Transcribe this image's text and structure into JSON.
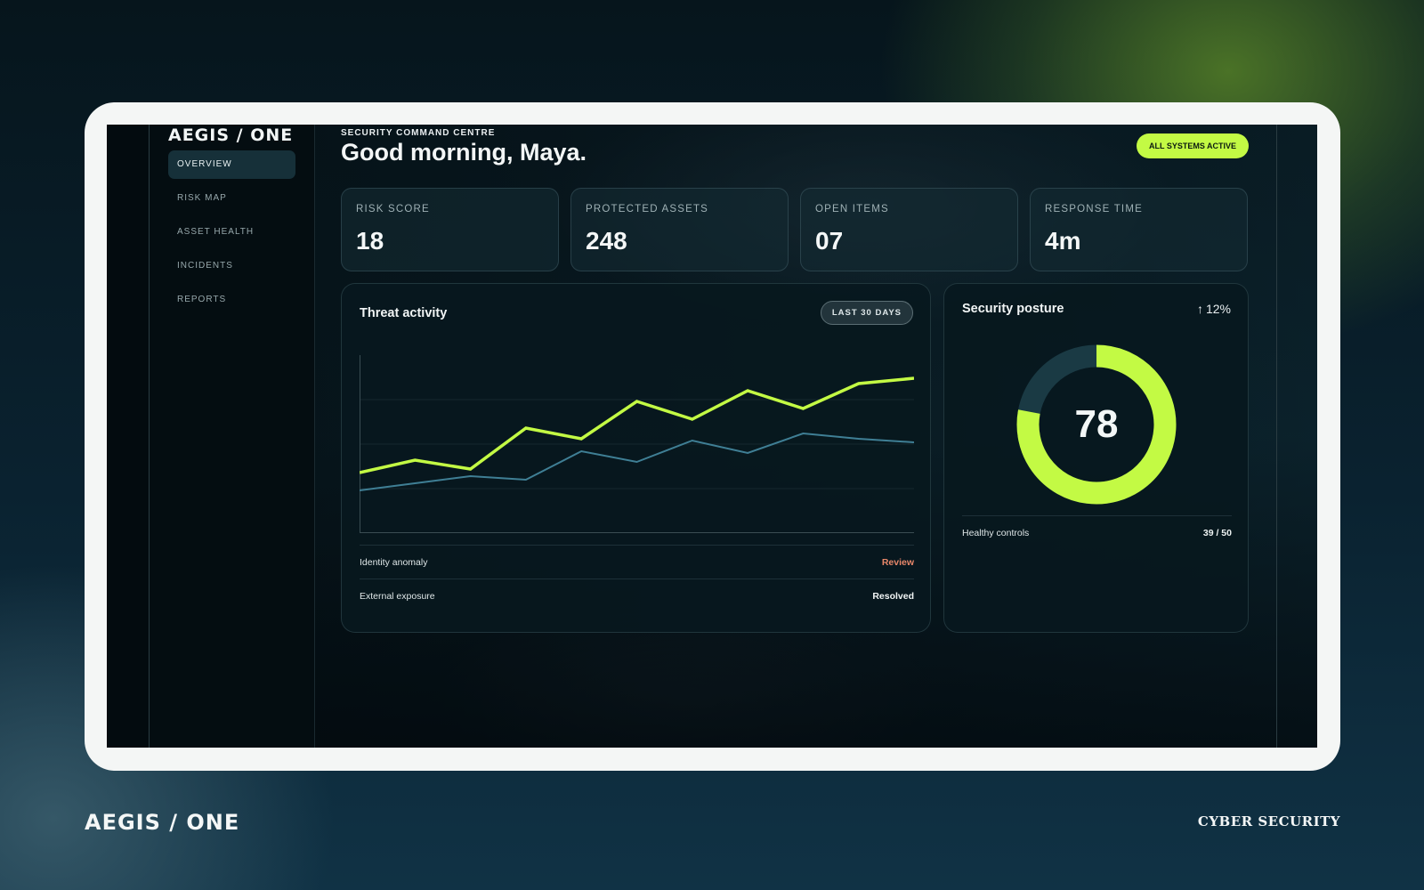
{
  "app": {
    "brand": "AEGIS / ONE",
    "footer_brand": "AEGIS / ONE",
    "footer_tag": "CYBER SECURITY"
  },
  "sidebar": {
    "items": [
      {
        "label": "OVERVIEW",
        "active": true
      },
      {
        "label": "RISK MAP",
        "active": false
      },
      {
        "label": "ASSET HEALTH",
        "active": false
      },
      {
        "label": "INCIDENTS",
        "active": false
      },
      {
        "label": "REPORTS",
        "active": false
      }
    ]
  },
  "header": {
    "eyebrow": "SECURITY COMMAND CENTRE",
    "greeting": "Good morning, Maya.",
    "status": "ALL SYSTEMS ACTIVE"
  },
  "kpis": [
    {
      "label": "RISK SCORE",
      "value": "18"
    },
    {
      "label": "PROTECTED ASSETS",
      "value": "248"
    },
    {
      "label": "OPEN ITEMS",
      "value": "07"
    },
    {
      "label": "RESPONSE TIME",
      "value": "4m"
    }
  ],
  "threat": {
    "title": "Threat activity",
    "range": "LAST 30 DAYS",
    "items": [
      {
        "label": "Identity anomaly",
        "status": "Review",
        "status_color": "#e8876a"
      },
      {
        "label": "External exposure",
        "status": "Resolved",
        "status_color": "#f1f5f5"
      }
    ]
  },
  "posture": {
    "title": "Security posture",
    "trend": "12%",
    "trend_icon": "arrow-up-icon",
    "score": "78",
    "score_fraction": 0.78,
    "footer_label": "Healthy controls",
    "footer_value": "39 / 50"
  },
  "colors": {
    "accent": "#c3fa44",
    "secondary": "#3f7f95",
    "track": "#1a3a44"
  },
  "chart_data": {
    "type": "line",
    "title": "Threat activity",
    "x": [
      0,
      1,
      2,
      3,
      4,
      5,
      6,
      7,
      8,
      9,
      10
    ],
    "ylim": [
      0,
      100
    ],
    "grid": true,
    "series": [
      {
        "color": "#c3fa44",
        "values": [
          34,
          41,
          36,
          59,
          53,
          74,
          64,
          80,
          70,
          84,
          87
        ]
      },
      {
        "color": "#3f7f95",
        "values": [
          24,
          28,
          32,
          30,
          46,
          40,
          52,
          45,
          56,
          53,
          51
        ]
      }
    ]
  }
}
